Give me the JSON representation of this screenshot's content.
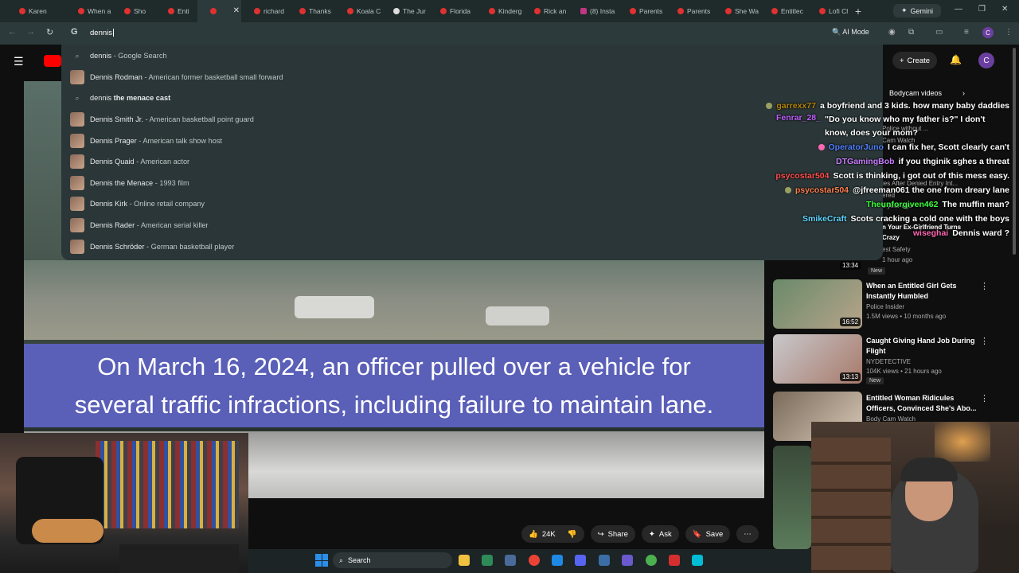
{
  "tabs": [
    {
      "label": "Karen",
      "favicon": "youtube"
    },
    {
      "label": "When a",
      "favicon": "youtube"
    },
    {
      "label": "Sho",
      "favicon": "youtube"
    },
    {
      "label": "Enti",
      "favicon": "youtube"
    },
    {
      "label": "",
      "favicon": "youtube",
      "active": true
    },
    {
      "label": "richard",
      "favicon": "youtube"
    },
    {
      "label": "Thanks",
      "favicon": "youtube"
    },
    {
      "label": "Koala C",
      "favicon": "youtube"
    },
    {
      "label": "The Jur",
      "favicon": "google"
    },
    {
      "label": "Florida",
      "favicon": "youtube"
    },
    {
      "label": "Kinderg",
      "favicon": "youtube"
    },
    {
      "label": "Rick an",
      "favicon": "youtube"
    },
    {
      "label": "(8) Insta",
      "favicon": "instagram"
    },
    {
      "label": "Parents",
      "favicon": "youtube"
    },
    {
      "label": "Parents",
      "favicon": "youtube"
    },
    {
      "label": "She Wa",
      "favicon": "youtube"
    },
    {
      "label": "Entitlec",
      "favicon": "youtube"
    },
    {
      "label": "Lofi Ch",
      "favicon": "youtube"
    }
  ],
  "browser": {
    "gemini_label": "Gemini",
    "omnibox_value": "dennis",
    "ai_mode_label": "AI Mode",
    "profile_initial": "C"
  },
  "suggestions": [
    {
      "bold": "dennis",
      "desc": " - Google Search",
      "type": "search"
    },
    {
      "bold": "Dennis Rodman",
      "desc": " - American former basketball small forward",
      "type": "entity"
    },
    {
      "bold": "dennis ",
      "rest": "the menace cast",
      "type": "search"
    },
    {
      "bold": "Dennis Smith Jr.",
      "desc": " - American basketball point guard",
      "type": "entity"
    },
    {
      "bold": "Dennis Prager",
      "desc": " - American talk show host",
      "type": "entity"
    },
    {
      "bold": "Dennis Quaid",
      "desc": " - American actor",
      "type": "entity"
    },
    {
      "bold": "Dennis the Menace",
      "desc": " - 1993 film",
      "type": "entity"
    },
    {
      "bold": "Dennis Kirk",
      "desc": " - Online retail company",
      "type": "entity"
    },
    {
      "bold": "Dennis Rader",
      "desc": " - American serial killer",
      "type": "entity"
    },
    {
      "bold": "Dennis Schröder",
      "desc": " - German basketball player",
      "type": "entity"
    }
  ],
  "youtube": {
    "create_label": "Create",
    "avatar_initial": "C",
    "caption_line1": "On March 16, 2024, an officer pulled over a vehicle for",
    "caption_line2": "several traffic infractions, including failure to maintain lane.",
    "like_count": "24K",
    "share_label": "Share",
    "ask_label": "Ask",
    "save_label": "Save",
    "sidebar_chip": "Bodycam videos"
  },
  "partial_recs": [
    {
      "text": "Police without ..."
    },
    {
      "text": "Cam Watch"
    },
    {
      "text": "ies After Denied Entry Int..."
    },
    {
      "text": "ered"
    },
    {
      "text": "1 year ago"
    },
    {
      "text": "n Your Ex-Girlfriend Turns"
    },
    {
      "text": "Crazy"
    },
    {
      "text": "est Safety"
    },
    {
      "text": "1 hour ago"
    }
  ],
  "recommendations": [
    {
      "title": "When an Entitled Girl Gets Instantly Humbled",
      "channel": "Police Insider",
      "meta": "1.5M views • 10 months ago",
      "duration": "16:52",
      "badge": ""
    },
    {
      "title": "Caught Giving Hand Job During Flight",
      "channel": "NYDETECTIVE",
      "meta": "104K views • 21 hours ago",
      "duration": "13:13",
      "badge": "New"
    },
    {
      "title": "Entitled Woman Ridicules Officers, Convinced She's Abo...",
      "channel": "Body Cam Watch",
      "meta": "",
      "duration": "",
      "badge": ""
    }
  ],
  "first_duration": "13:34",
  "first_badge": "New",
  "chat": [
    {
      "user": "garrexx77",
      "color": "#b8860b",
      "msg": "a boyfriend and 3 kids. how many baby daddies"
    },
    {
      "user": "Fenrar_28_",
      "color": "#c061ff",
      "msg": "\"Do you know who my father is?\" I don't know, does your mom?"
    },
    {
      "user": "OperatorJuno",
      "color": "#4f7fff",
      "msg": "I can fix her, Scott clearly can't"
    },
    {
      "user": "DTGamingBob",
      "color": "#c77dff",
      "msg": "if you thginik sghes a threat"
    },
    {
      "user": "psycostar504",
      "color": "#ff4f4f",
      "msg": "Scott is thinking, i got out of this mess easy."
    },
    {
      "user": "psycostar504",
      "color": "#ff7f50",
      "msg": "@jfreeman061 the one from dreary lane"
    },
    {
      "user": "Theunforgiven462",
      "color": "#3cff3c",
      "msg": "The muffin man?"
    },
    {
      "user": "SmikeCraft",
      "color": "#5fd7ff",
      "msg": "Scots cracking a cold one with the boys"
    },
    {
      "user": "wiseghai",
      "color": "#ff69b4",
      "msg": "Dennis ward ?"
    }
  ],
  "taskbar": {
    "search_label": "Search"
  },
  "colors": {
    "youtube_red": "#ff0000",
    "caption_bg": "#5a5fb8",
    "dropdown_bg": "#2a3637"
  }
}
